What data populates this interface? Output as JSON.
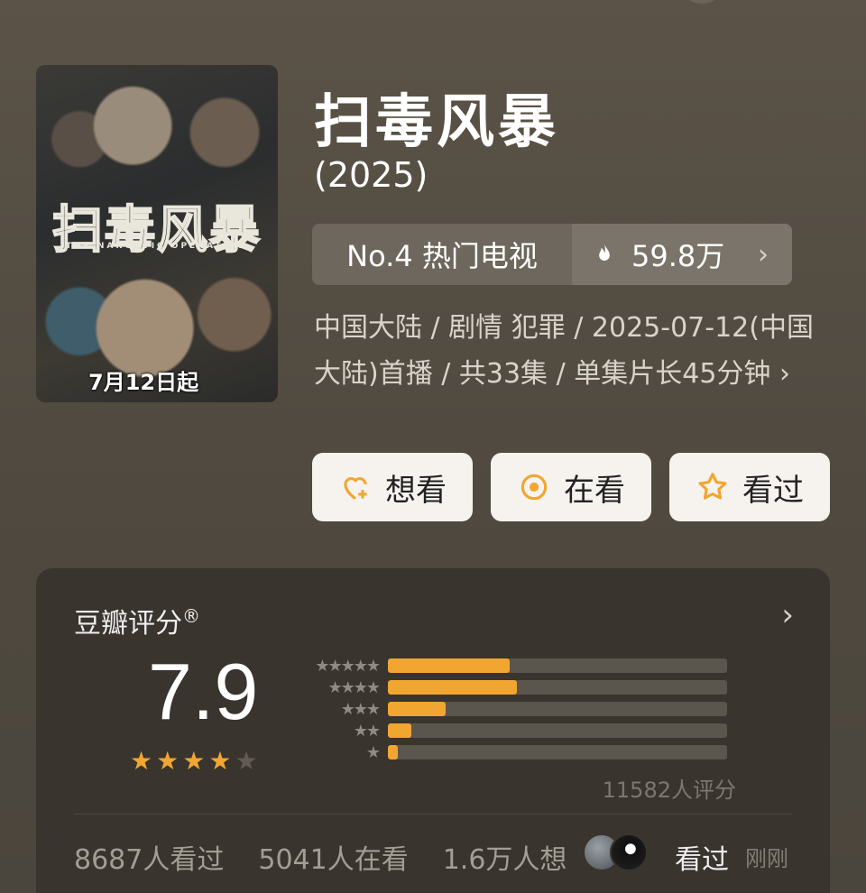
{
  "poster": {
    "title": "扫毒风暴",
    "subtitle_en": "THE NARCOTIC OPERATION",
    "date": "7月12日起"
  },
  "header": {
    "title": "扫毒风暴",
    "year": "(2025)"
  },
  "rank": {
    "label": "No.4 热门电视",
    "heat": "59.8万",
    "chevron": "›"
  },
  "meta": {
    "text": "中国大陆 / 剧情 犯罪 / 2025-07-12(中国大陆)首播 / 共33集 / 单集片长45分钟 ›"
  },
  "actions": {
    "want": "想看",
    "watching": "在看",
    "watched": "看过"
  },
  "rating": {
    "label": "豆瓣评分",
    "reg_mark": "®",
    "chevron": "›",
    "score": "7.9",
    "stars": 4,
    "count": "11582人评分",
    "distribution": [
      {
        "stars": 5,
        "ratio": 0.36
      },
      {
        "stars": 4,
        "ratio": 0.38
      },
      {
        "stars": 3,
        "ratio": 0.17
      },
      {
        "stars": 2,
        "ratio": 0.07
      },
      {
        "stars": 1,
        "ratio": 0.03
      }
    ]
  },
  "stats": {
    "watched": "8687人看过",
    "watching": "5041人在看",
    "want": "1.6万人想",
    "friend_action": "看过",
    "friend_time": "刚刚"
  },
  "colors": {
    "accent": "#f2a632",
    "background": "#564f44",
    "card": "#39342d"
  }
}
